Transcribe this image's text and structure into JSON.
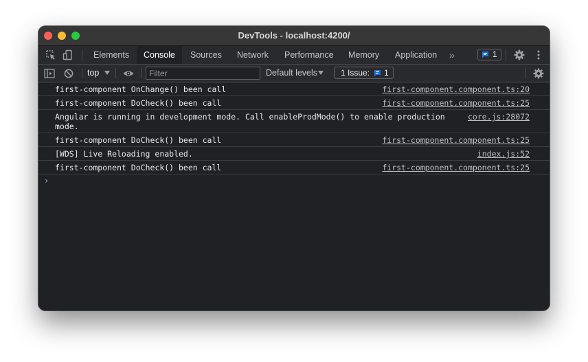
{
  "window": {
    "title": "DevTools - localhost:4200/"
  },
  "tabs": [
    {
      "label": "Elements",
      "active": false
    },
    {
      "label": "Console",
      "active": true
    },
    {
      "label": "Sources",
      "active": false
    },
    {
      "label": "Network",
      "active": false
    },
    {
      "label": "Performance",
      "active": false
    },
    {
      "label": "Memory",
      "active": false
    },
    {
      "label": "Application",
      "active": false
    }
  ],
  "tabsbar": {
    "more_tabs": "»",
    "messages_count": "1"
  },
  "toolbar": {
    "context": "top",
    "filter_placeholder": "Filter",
    "filter_value": "",
    "levels": "Default levels",
    "issues_label": "1 Issue:",
    "issues_count": "1"
  },
  "console": {
    "messages": [
      {
        "text": "first-component OnChange() been call",
        "source": "first-component.component.ts:20"
      },
      {
        "text": "first-component DoCheck() been call",
        "source": "first-component.component.ts:25"
      },
      {
        "text": "Angular is running in development mode. Call enableProdMode() to enable production mode.",
        "source": "core.js:28072"
      },
      {
        "text": "first-component DoCheck() been call",
        "source": "first-component.component.ts:25"
      },
      {
        "text": "[WDS] Live Reloading enabled.",
        "source": "index.js:52"
      },
      {
        "text": "first-component DoCheck() been call",
        "source": "first-component.component.ts:25"
      }
    ],
    "prompt_symbol": "›"
  },
  "colors": {
    "background": "#202124",
    "toolbar": "#292a2d",
    "titlebar": "#373737",
    "accent_blue": "#1a73e8",
    "prompt_blue": "#8ab4f8",
    "close": "#fe5f57",
    "minimize": "#febc2e",
    "maximize": "#28c840"
  },
  "icons": {
    "inspect": "inspect-element-icon",
    "device": "device-toolbar-icon",
    "settings": "gear-icon",
    "menu": "kebab-menu-icon",
    "sidebar": "sidebar-toggle-icon",
    "clear": "clear-console-icon",
    "live_expression": "eye-icon",
    "message": "message-icon"
  }
}
